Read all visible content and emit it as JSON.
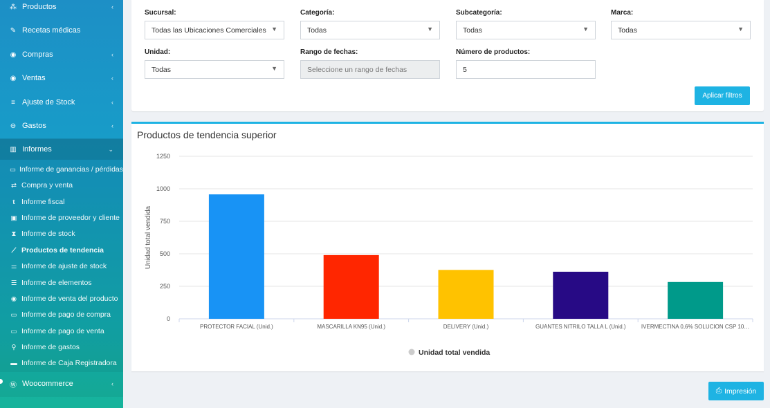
{
  "sidebar": {
    "items": [
      {
        "label": "Productos",
        "icon": "cubes-icon",
        "chevron": "‹"
      },
      {
        "label": "Recetas médicas",
        "icon": "edit-icon",
        "chevron": ""
      },
      {
        "label": "Compras",
        "icon": "arrow-circle-down-icon",
        "chevron": "‹"
      },
      {
        "label": "Ventas",
        "icon": "arrow-circle-up-icon",
        "chevron": "‹"
      },
      {
        "label": "Ajuste de Stock",
        "icon": "database-icon",
        "chevron": "‹"
      },
      {
        "label": "Gastos",
        "icon": "minus-circle-icon",
        "chevron": "‹"
      },
      {
        "label": "Informes",
        "icon": "bar-chart-icon",
        "chevron": "⌄"
      }
    ],
    "sub_items": [
      {
        "label": "Informe de ganancias / pérdidas",
        "icon": "money-icon"
      },
      {
        "label": "Compra y venta",
        "icon": "exchange-icon"
      },
      {
        "label": "Informe fiscal",
        "icon": "tumblr-icon"
      },
      {
        "label": "Informe de proveedor y cliente",
        "icon": "address-book-icon"
      },
      {
        "label": "Informe de stock",
        "icon": "hourglass-icon"
      },
      {
        "label": "Productos de tendencia",
        "icon": "line-chart-icon"
      },
      {
        "label": "Informe de ajuste de stock",
        "icon": "sliders-icon"
      },
      {
        "label": "Informe de elementos",
        "icon": "list-icon"
      },
      {
        "label": "Informe de venta del producto",
        "icon": "arrow-circle-up-icon"
      },
      {
        "label": "Informe de pago de compra",
        "icon": "money-icon"
      },
      {
        "label": "Informe de pago de venta",
        "icon": "money-icon"
      },
      {
        "label": "Informe de gastos",
        "icon": "search-icon"
      },
      {
        "label": "Informe de Caja Registradora",
        "icon": "briefcase-icon"
      }
    ],
    "woo": {
      "label": "Woocommerce",
      "icon": "wordpress-icon",
      "chevron": "‹"
    }
  },
  "filters": {
    "sucursal": {
      "label": "Sucursal:",
      "value": "Todas las Ubicaciones Comerciales"
    },
    "categoria": {
      "label": "Categoría:",
      "value": "Todas"
    },
    "subcategoria": {
      "label": "Subcategoría:",
      "value": "Todas"
    },
    "marca": {
      "label": "Marca:",
      "value": "Todas"
    },
    "unidad": {
      "label": "Unidad:",
      "value": "Todas"
    },
    "rango": {
      "label": "Rango de fechas:",
      "placeholder": "Seleccione un rango de fechas"
    },
    "numero": {
      "label": "Número de productos:",
      "value": "5"
    },
    "apply_label": "Aplicar filtros"
  },
  "chart_data": {
    "type": "bar",
    "title": "Productos de tendencia superior",
    "categories": [
      "PROTECTOR FACIAL (Unid.)",
      "MASCARILLA KN95 (Unid.)",
      "DELIVERY (Unid.)",
      "GUANTES NITRILO TALLA L (Unid.)",
      "IVERMECTINA 0,6% SOLUCION CSP 10…"
    ],
    "values": [
      957,
      490,
      376,
      362,
      283
    ],
    "colors": [
      "#1893f5",
      "#ff2600",
      "#ffc200",
      "#270a85",
      "#009a8a"
    ],
    "ylabel": "Unidad total vendida",
    "yticks": [
      0,
      250,
      500,
      750,
      1000,
      1250
    ],
    "ylim": [
      0,
      1250
    ],
    "legend": "Unidad total vendida",
    "legend_position": "bottom"
  },
  "print_label": "Impresión"
}
